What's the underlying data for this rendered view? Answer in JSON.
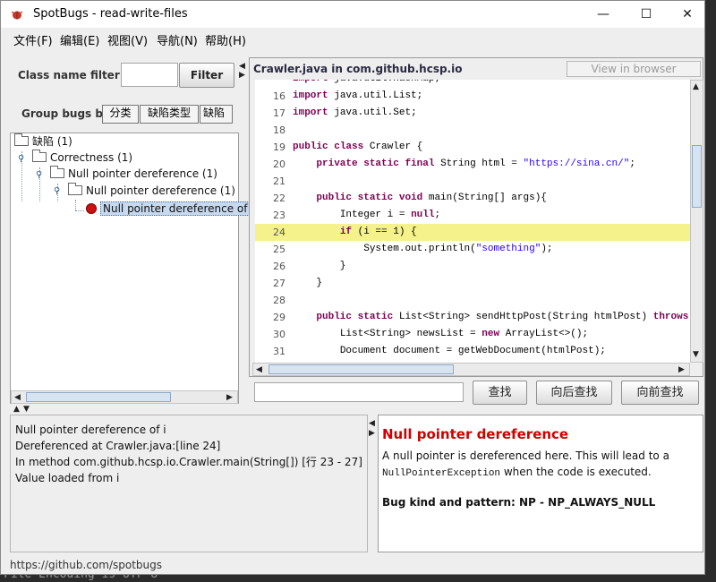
{
  "window": {
    "title": "SpotBugs - read-write-files",
    "minimize": "—",
    "maximize": "☐",
    "close": "✕"
  },
  "background": {
    "bottom_text": "File Encoding is UTF-8"
  },
  "menu": [
    {
      "label": "文件(F)"
    },
    {
      "label": "编辑(E)"
    },
    {
      "label": "视图(V)"
    },
    {
      "label": "导航(N)"
    },
    {
      "label": "帮助(H)"
    }
  ],
  "filter": {
    "label": "Class name filter:",
    "value": "",
    "button": "Filter"
  },
  "group": {
    "label": "Group bugs by:",
    "options": [
      "分类",
      "缺陷类型",
      "缺陷"
    ]
  },
  "tree": {
    "root": "缺陷 (1)",
    "category": "Correctness (1)",
    "type": "Null pointer dereference (1)",
    "pattern": "Null pointer dereference (1)",
    "bug": "Null pointer dereference of i"
  },
  "source": {
    "header": "Crawler.java in com.github.hcsp.io",
    "view_button": "View in browser",
    "highlight_line": "24",
    "lines": [
      {
        "num": "",
        "text": "import java.util.HashMap;"
      },
      {
        "num": "16",
        "text": "import java.util.List;"
      },
      {
        "num": "17",
        "text": "import java.util.Set;"
      },
      {
        "num": "18",
        "text": ""
      },
      {
        "num": "19",
        "text": "public class Crawler {"
      },
      {
        "num": "20",
        "text": "    private static final String html = \"https://sina.cn/\";"
      },
      {
        "num": "21",
        "text": ""
      },
      {
        "num": "22",
        "text": "    public static void main(String[] args){"
      },
      {
        "num": "23",
        "text": "        Integer i = null;"
      },
      {
        "num": "24",
        "text": "        if (i == 1) {"
      },
      {
        "num": "25",
        "text": "            System.out.println(\"something\");"
      },
      {
        "num": "26",
        "text": "        }"
      },
      {
        "num": "27",
        "text": "    }"
      },
      {
        "num": "28",
        "text": ""
      },
      {
        "num": "29",
        "text": "    public static List<String> sendHttpPost(String htmlPost) throws IOE"
      },
      {
        "num": "30",
        "text": "        List<String> newsList = new ArrayList<>();"
      },
      {
        "num": "31",
        "text": "        Document document = getWebDocument(htmlPost);"
      }
    ]
  },
  "search": {
    "value": "",
    "find": "查找",
    "find_next": "向后查找",
    "find_prev": "向前查找"
  },
  "details": {
    "lines": [
      "Null pointer dereference of i",
      "Dereferenced at Crawler.java:[line 24]",
      "In method com.github.hcsp.io.Crawler.main(String[]) [行 23 - 27]",
      "Value loaded from i"
    ]
  },
  "description": {
    "title": "Null pointer dereference",
    "text_before": "A null pointer is dereferenced here.  This will lead to a",
    "code": "NullPointerException",
    "text_after": " when the code is executed.",
    "bug_kind": "Bug kind and pattern: NP - NP_ALWAYS_NULL"
  },
  "status": {
    "text": "https://github.com/spotbugs"
  },
  "colors": {
    "highlight": "#f5f28c",
    "title_red": "#d00000",
    "keyword": "#7f0055",
    "string": "#2a00ff"
  }
}
